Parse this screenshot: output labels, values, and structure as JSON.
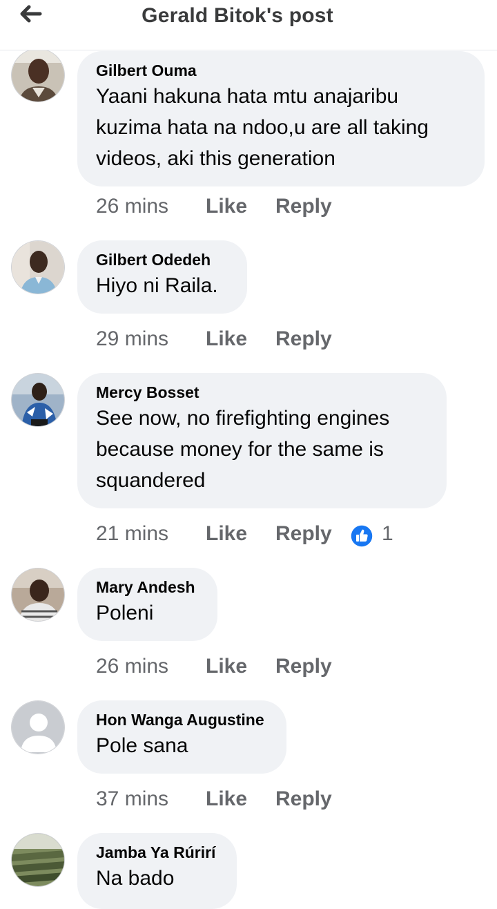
{
  "header": {
    "title": "Gerald Bitok's post",
    "back_icon": "arrow-left-icon"
  },
  "comments": [
    {
      "author": "Gilbert Ouma",
      "text": "Yaani hakuna hata mtu anajaribu kuzima hata na ndoo,u are all taking videos, aki this generation",
      "time": "26 mins",
      "like": "Like",
      "reply": "Reply"
    },
    {
      "author": "Gilbert Odedeh",
      "text": "Hiyo ni Raila.",
      "time": "29 mins",
      "like": "Like",
      "reply": "Reply"
    },
    {
      "author": "Mercy Bosset",
      "text": "See now, no firefighting engines because money for the same is squandered",
      "time": "21 mins",
      "like": "Like",
      "reply": "Reply",
      "reaction_icon": "like-reaction-icon",
      "reaction_count": "1"
    },
    {
      "author": "Mary Andesh",
      "text": "Poleni",
      "time": "26 mins",
      "like": "Like",
      "reply": "Reply"
    },
    {
      "author": "Hon Wanga Augustine",
      "text": "Pole sana",
      "time": "37 mins",
      "like": "Like",
      "reply": "Reply"
    },
    {
      "author": "Jamba Ya Rúrirí",
      "text": "Na bado"
    }
  ],
  "colors": {
    "bubble": "#f0f2f5",
    "secondary_text": "#65676b",
    "like_blue": "#1877f2"
  }
}
